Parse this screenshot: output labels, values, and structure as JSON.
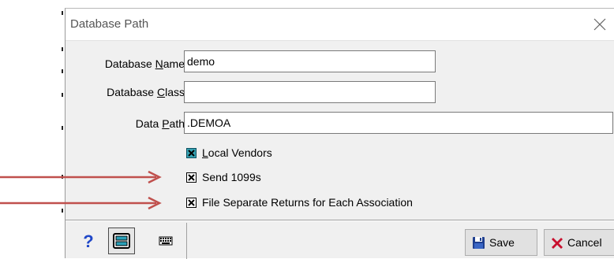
{
  "dialog": {
    "title": "Database Path",
    "close_glyph": "✕"
  },
  "fields": {
    "database_name": {
      "label_pre": "Database ",
      "label_mnemonic": "N",
      "label_post": "ame",
      "value": "demo"
    },
    "database_class": {
      "label_pre": "Database ",
      "label_mnemonic": "C",
      "label_post": "lass",
      "value": ""
    },
    "data_path": {
      "label_pre": "Data ",
      "label_mnemonic": "P",
      "label_post": "ath",
      "value": ".DEMOA"
    }
  },
  "checkboxes": [
    {
      "label_mnemonic": "L",
      "label_rest": "ocal Vendors",
      "checked": true,
      "style": "teal"
    },
    {
      "label_mnemonic": "",
      "label_rest": "Send 1099s",
      "checked": true,
      "style": "plain"
    },
    {
      "label_mnemonic": "",
      "label_rest": "File Separate Returns for Each Association",
      "checked": true,
      "style": "plain"
    }
  ],
  "toolbar": {
    "help_icon": "question-mark-icon",
    "scan_icon": "scanner-icon",
    "keyboard_icon": "keyboard-icon"
  },
  "buttons": {
    "save_label": "Save",
    "cancel_label": "Cancel"
  },
  "colors": {
    "arrow": "#c0504d",
    "teal_check": "#37a3b3",
    "help_icon": "#2048c8",
    "cancel_x": "#c8102e",
    "save_disk": "#1f3f8f"
  }
}
